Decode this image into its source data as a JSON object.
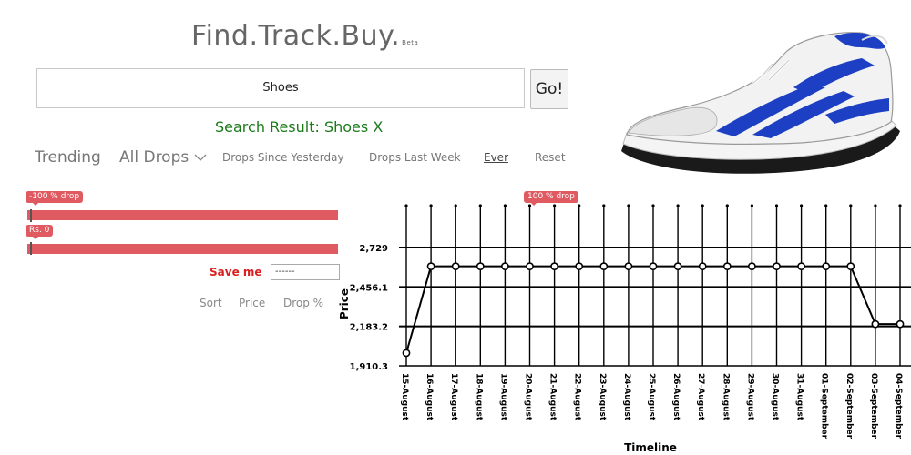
{
  "logo": {
    "text": "Find.Track.Buy.",
    "beta": "Beta"
  },
  "search": {
    "value": "Shoes",
    "button": "Go!"
  },
  "result": {
    "text": "Search Result: Shoes X"
  },
  "nav": {
    "trending": "Trending",
    "all_drops": "All Drops",
    "since_yesterday": "Drops Since Yesterday",
    "last_week": "Drops Last Week",
    "ever": "Ever",
    "reset": "Reset"
  },
  "filters": {
    "drop_min_label": "-100 % drop",
    "drop_max_label": "100 % drop",
    "price_min_label": "Rs. 0",
    "drop_slider_low": 0,
    "price_slider_low": 0
  },
  "save": {
    "label": "Save me",
    "select_value": "------"
  },
  "sort": {
    "label": "Sort",
    "price": "Price",
    "drop": "Drop %"
  },
  "colors": {
    "accent_red": "#e05a62",
    "result_green": "#1a7a1a",
    "save_red": "#d92020",
    "shoe_blue": "#1c3fc4"
  },
  "chart_data": {
    "type": "line",
    "ylabel": "Price",
    "xlabel": "Timeline",
    "yticks": [
      "2,729",
      "2,456.1",
      "2,183.2",
      "1,910.3"
    ],
    "ytick_values": [
      2729,
      2456.1,
      2183.2,
      1910.3
    ],
    "ylim": [
      1910.3,
      2729
    ],
    "x": [
      "15-August",
      "16-August",
      "17-August",
      "18-August",
      "19-August",
      "20-August",
      "21-August",
      "22-August",
      "23-August",
      "24-August",
      "25-August",
      "26-August",
      "27-August",
      "28-August",
      "29-August",
      "30-August",
      "31-August",
      "01-September",
      "02-September",
      "03-September",
      "04-September"
    ],
    "values": [
      1999,
      2599,
      2599,
      2599,
      2599,
      2599,
      2599,
      2599,
      2599,
      2599,
      2599,
      2599,
      2599,
      2599,
      2599,
      2599,
      2599,
      2599,
      2599,
      2199,
      2199
    ],
    "grid": true
  }
}
